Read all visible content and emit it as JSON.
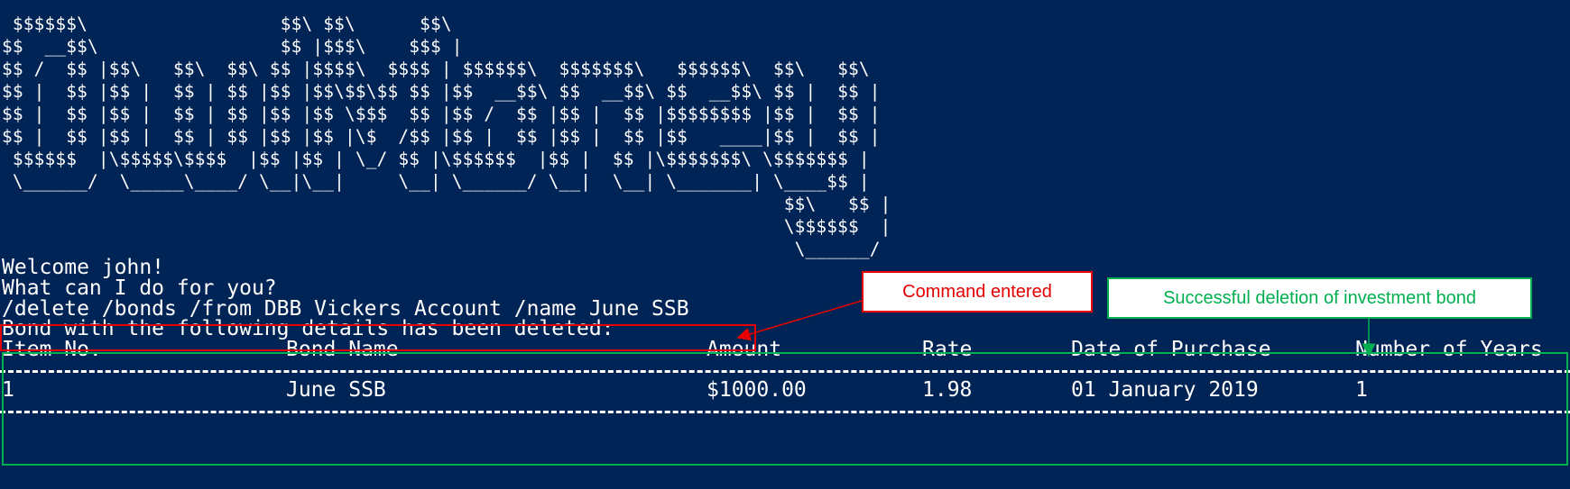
{
  "banner": {
    "ascii_art": " $$$$$$\\                  $$\\ $$\\      $$\\\n$$  __$$\\                 $$ |$$$\\    $$$ |\n$$ /  $$ |$$\\   $$\\  $$\\ $$ |$$$$\\  $$$$ | $$$$$$\\  $$$$$$$\\   $$$$$$\\  $$\\   $$\\\n$$ |  $$ |$$ |  $$ | $$ |$$ |$$\\$$\\$$ $$ |$$  __$$\\ $$  __$$\\ $$  __$$\\ $$ |  $$ |\n$$ |  $$ |$$ |  $$ | $$ |$$ |$$ \\$$$  $$ |$$ /  $$ |$$ |  $$ |$$$$$$$$ |$$ |  $$ |\n$$ |  $$ |$$ |  $$ | $$ |$$ |$$ |\\$  /$$ |$$ |  $$ |$$ |  $$ |$$   ____|$$ |  $$ |\n $$$$$$  |\\$$$$$\\$$$$  |$$ |$$ | \\_/ $$ |\\$$$$$$  |$$ |  $$ |\\$$$$$$$\\ \\$$$$$$$ |\n \\______/  \\_____\\____/ \\__|\\__|     \\__| \\______/ \\__|  \\__| \\_______| \\____$$ |\n                                                                         $$\\   $$ |\n                                                                         \\$$$$$$  |\n                                                                          \\______/"
  },
  "console": {
    "welcome": "Welcome john!",
    "prompt": "What can I do for you?",
    "command": "/delete /bonds /from DBB Vickers Account /name June SSB",
    "result_message": "Bond with the following details has been deleted:"
  },
  "table": {
    "headers": [
      "Item No.",
      "Bond Name",
      "Amount",
      "Rate",
      "Date of Purchase",
      "Number of Years"
    ],
    "rows": [
      [
        "1",
        "June SSB",
        "$1000.00",
        "1.98",
        "01 January 2019",
        "1"
      ]
    ]
  },
  "annotations": {
    "command_label": "Command entered",
    "success_label": "Successful deletion of investment bond",
    "command_color": "#e60000",
    "success_color": "#00b050"
  },
  "colors": {
    "background": "#012456",
    "text": "#ffffff"
  }
}
